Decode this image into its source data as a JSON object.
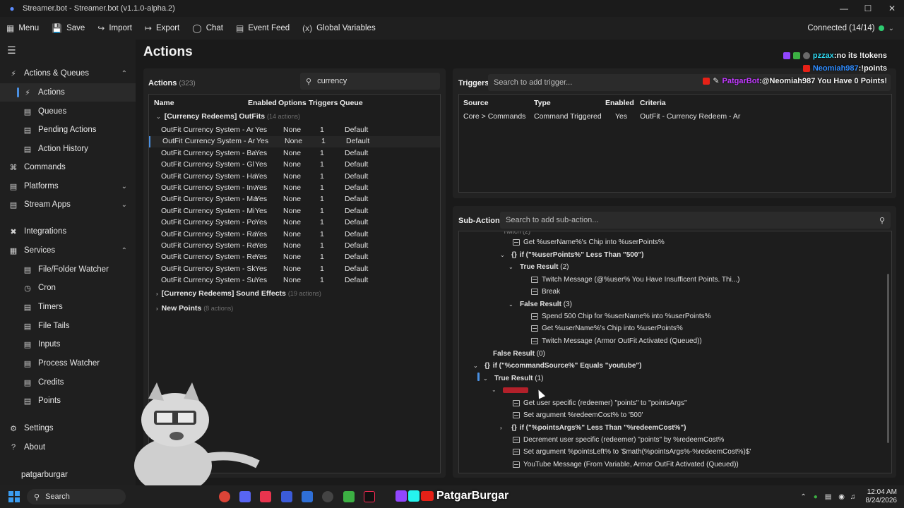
{
  "window": {
    "title": "Streamer.bot - Streamer.bot (v1.1.0-alpha.2)"
  },
  "toolbar": {
    "menu": "Menu",
    "save": "Save",
    "import": "Import",
    "export": "Export",
    "chat": "Chat",
    "event_feed": "Event Feed",
    "global_variables": "Global Variables",
    "connection": "Connected (14/14)"
  },
  "sidebar": {
    "actions_queues": "Actions & Queues",
    "actions": "Actions",
    "queues": "Queues",
    "pending_actions": "Pending Actions",
    "action_history": "Action History",
    "commands": "Commands",
    "platforms": "Platforms",
    "stream_apps": "Stream Apps",
    "integrations": "Integrations",
    "services": "Services",
    "file_folder_watcher": "File/Folder Watcher",
    "cron": "Cron",
    "timers": "Timers",
    "file_tails": "File Tails",
    "inputs": "Inputs",
    "process_watcher": "Process Watcher",
    "credits": "Credits",
    "points": "Points",
    "settings": "Settings",
    "about": "About",
    "user": "patgarburgar"
  },
  "page_title": "Actions",
  "actions_panel": {
    "title": "Actions",
    "count": "(323)",
    "search_value": "currency",
    "columns": [
      "Name",
      "Enabled",
      "Options",
      "Triggers",
      "Queue"
    ],
    "group1": {
      "name": "[Currency Redeems] OutFits",
      "count": "(14 actions)"
    },
    "rows": [
      [
        "OutFit Currency System - Ar",
        "Yes",
        "None",
        "1",
        "Default"
      ],
      [
        "OutFit Currency System - Ar",
        "Yes",
        "None",
        "1",
        "Default"
      ],
      [
        "OutFit Currency System - Ba",
        "Yes",
        "None",
        "1",
        "Default"
      ],
      [
        "OutFit Currency System - Gl",
        "Yes",
        "None",
        "1",
        "Default"
      ],
      [
        "OutFit Currency System - Ha",
        "Yes",
        "None",
        "1",
        "Default"
      ],
      [
        "OutFit Currency System - Inv",
        "Yes",
        "None",
        "1",
        "Default"
      ],
      [
        "OutFit Currency System - Ma",
        "Yes",
        "None",
        "1",
        "Default"
      ],
      [
        "OutFit Currency System - Mi",
        "Yes",
        "None",
        "1",
        "Default"
      ],
      [
        "OutFit Currency System - Po",
        "Yes",
        "None",
        "1",
        "Default"
      ],
      [
        "OutFit Currency System - Ra",
        "Yes",
        "None",
        "1",
        "Default"
      ],
      [
        "OutFit Currency System - Re",
        "Yes",
        "None",
        "1",
        "Default"
      ],
      [
        "OutFit Currency System - Re",
        "Yes",
        "None",
        "1",
        "Default"
      ],
      [
        "OutFit Currency System - Sk",
        "Yes",
        "None",
        "1",
        "Default"
      ],
      [
        "OutFit Currency System - Su",
        "Yes",
        "None",
        "1",
        "Default"
      ]
    ],
    "group2": {
      "name": "[Currency Redeems] Sound Effects",
      "count": "(19 actions)"
    },
    "group3": {
      "name": "New Points",
      "count": "(8 actions)"
    }
  },
  "triggers_panel": {
    "title": "Triggers",
    "search_placeholder": "Search to add trigger...",
    "columns": [
      "Source",
      "Type",
      "Enabled",
      "Criteria"
    ],
    "row": [
      "Core > Commands",
      "Command Triggered",
      "Yes",
      "OutFit - Currency Redeem - Ar"
    ]
  },
  "subactions_panel": {
    "title": "Sub-Actions",
    "search_placeholder": "Search to add sub-action...",
    "lines": [
      "Get %userName%'s Chip into %userPoints%",
      "if (\"%userPoints%\" Less Than \"500\")",
      "True Result",
      "(2)",
      "Twitch Message (@%user% You Have Insufficent Points. Thi...)",
      "Break",
      "False Result",
      "(3)",
      "Spend 500 Chip for %userName% into %userPoints%",
      "Get %userName%'s Chip into %userPoints%",
      "Twitch Message (Armor OutFit Activated (Queued))",
      "False Result",
      "(0)",
      "if (\"%commandSource%\" Equals \"youtube\")",
      "True Result",
      "(1)",
      "Get user specific (redeemer) \"points\" to \"pointsArgs\"",
      "Set argument %redeemCost% to '500'",
      "if (\"%pointsArgs%\" Less Than \"%redeemCost%\")",
      "Decrement user specific (redeemer) \"points\" by %redeemCost%",
      "Set argument %pointsLeft% to '$math(%pointsArgs%-%redeemCost%)$'",
      "YouTube Message (From Variable, Armor OutFit Activated (Queued))"
    ]
  },
  "chat_overlay": [
    {
      "user": "pzzax",
      "sep": " : ",
      "msg": "no its !tokens",
      "color": "#2fd8f0"
    },
    {
      "user": "Neomiah987",
      "sep": " : ",
      "msg": "!points",
      "color": "#2f8cff"
    },
    {
      "user": "PatgarBot",
      "sep": " : ",
      "msg": "@Neomiah987 You Have 0 Points!",
      "color": "#c23bff"
    }
  ],
  "taskbar": {
    "search": "Search",
    "streamer_name": "PatgarBurgar",
    "time": "12:04 AM",
    "date": "8/24/2026"
  }
}
